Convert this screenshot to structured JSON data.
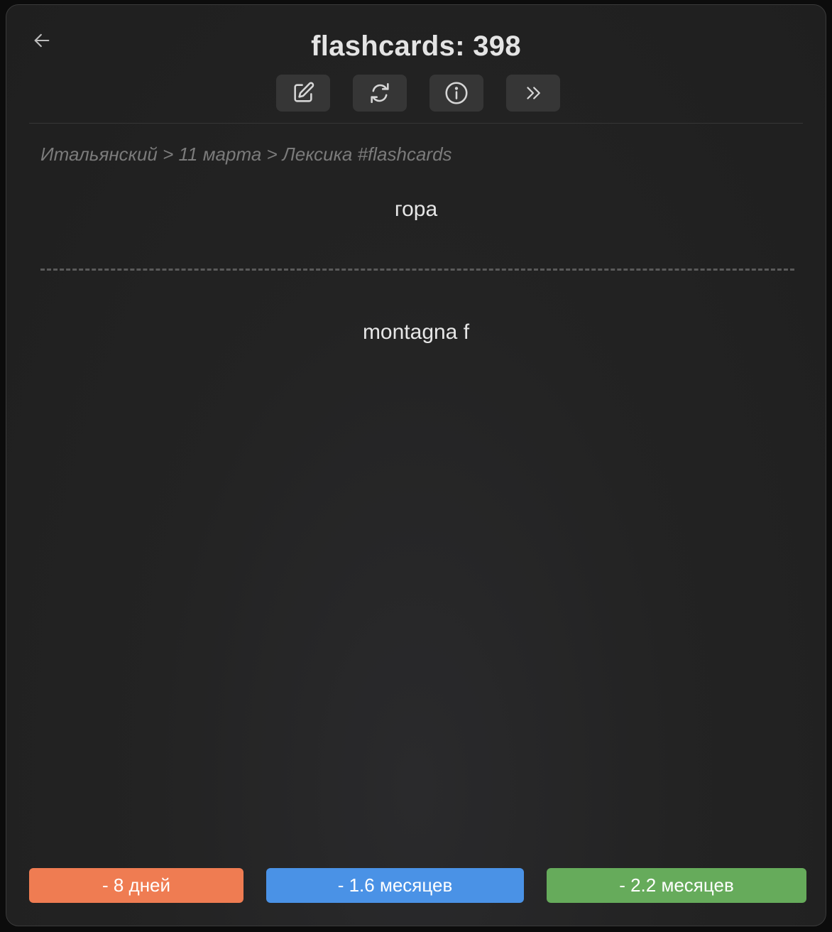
{
  "header": {
    "title": "flashcards: 398",
    "back_icon": "arrow-left-icon",
    "toolbar": [
      {
        "icon": "edit-icon",
        "name": "edit-button"
      },
      {
        "icon": "refresh-icon",
        "name": "reset-button"
      },
      {
        "icon": "info-icon",
        "name": "info-button"
      },
      {
        "icon": "chevrons-right-icon",
        "name": "skip-button"
      }
    ]
  },
  "card": {
    "breadcrumb": "Итальянский > 11 марта > Лексика #flashcards",
    "front": "гора",
    "back": "montagna f"
  },
  "answers": {
    "hard": {
      "label": "- 8 дней",
      "color": "#ef7c52"
    },
    "good": {
      "label": "- 1.6 месяцев",
      "color": "#4a92e6"
    },
    "easy": {
      "label": "- 2.2 месяцев",
      "color": "#66ab5b"
    }
  },
  "colors": {
    "background": "#232323",
    "text": "#e4e4e4",
    "muted": "#7b7b7b",
    "button_bg": "#363636"
  }
}
